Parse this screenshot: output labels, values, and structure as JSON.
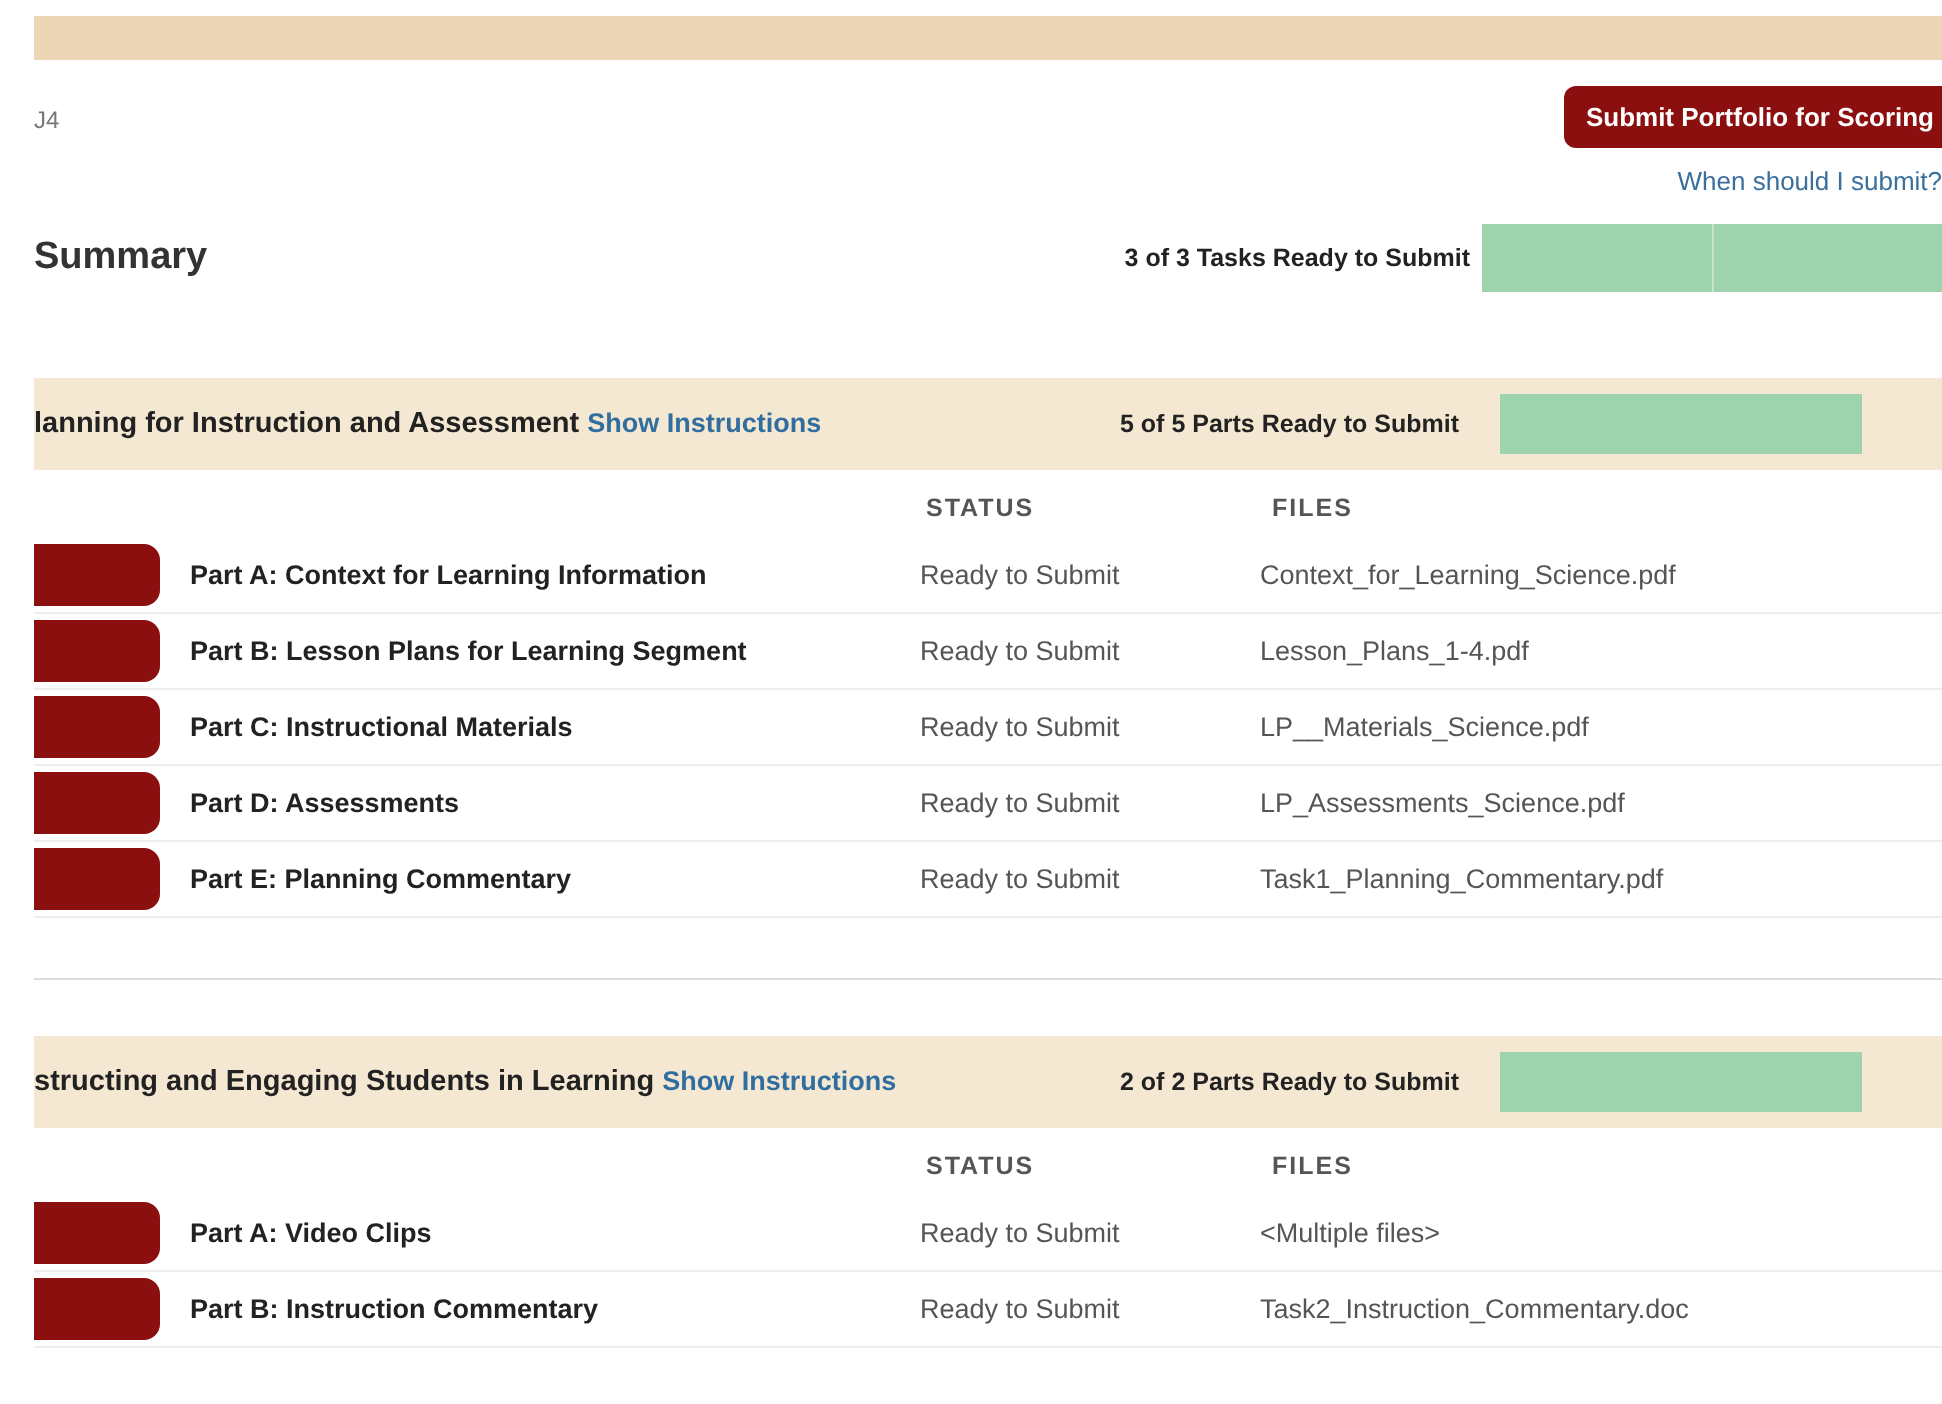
{
  "header": {
    "code": "J4",
    "submit_button": "Submit Portfolio for Scoring",
    "help_link": "When should I submit?"
  },
  "summary": {
    "title": "Summary",
    "progress_label": "3 of 3 Tasks Ready to Submit",
    "level": 1
  },
  "tasks": [
    {
      "title": "lanning for Instruction and Assessment",
      "instructions_link": "Show Instructions",
      "progress_label": "5 of 5 Parts Ready to Submit",
      "level": 1,
      "columns": [
        "STATUS",
        "FILES"
      ],
      "parts": [
        {
          "name": "Part A: Context for Learning Information",
          "status": "Ready to Submit",
          "file": "Context_for_Learning_Science.pdf"
        },
        {
          "name": "Part B: Lesson Plans for Learning Segment",
          "status": "Ready to Submit",
          "file": "Lesson_Plans_1-4.pdf"
        },
        {
          "name": "Part C: Instructional Materials",
          "status": "Ready to Submit",
          "file": "LP__Materials_Science.pdf"
        },
        {
          "name": "Part D: Assessments",
          "status": "Ready to Submit",
          "file": "LP_Assessments_Science.pdf"
        },
        {
          "name": "Part E: Planning Commentary",
          "status": "Ready to Submit",
          "file": "Task1_Planning_Commentary.pdf"
        }
      ]
    },
    {
      "title": "structing and Engaging Students in Learning",
      "instructions_link": "Show Instructions",
      "progress_label": "2 of 2 Parts Ready to Submit",
      "level": 1,
      "columns": [
        "STATUS",
        "FILES"
      ],
      "parts": [
        {
          "name": "Part A: Video Clips",
          "status": "Ready to Submit",
          "file": "<Multiple files>"
        },
        {
          "name": "Part B: Instruction Commentary",
          "status": "Ready to Submit",
          "file": "Task2_Instruction_Commentary.doc"
        }
      ]
    }
  ]
}
